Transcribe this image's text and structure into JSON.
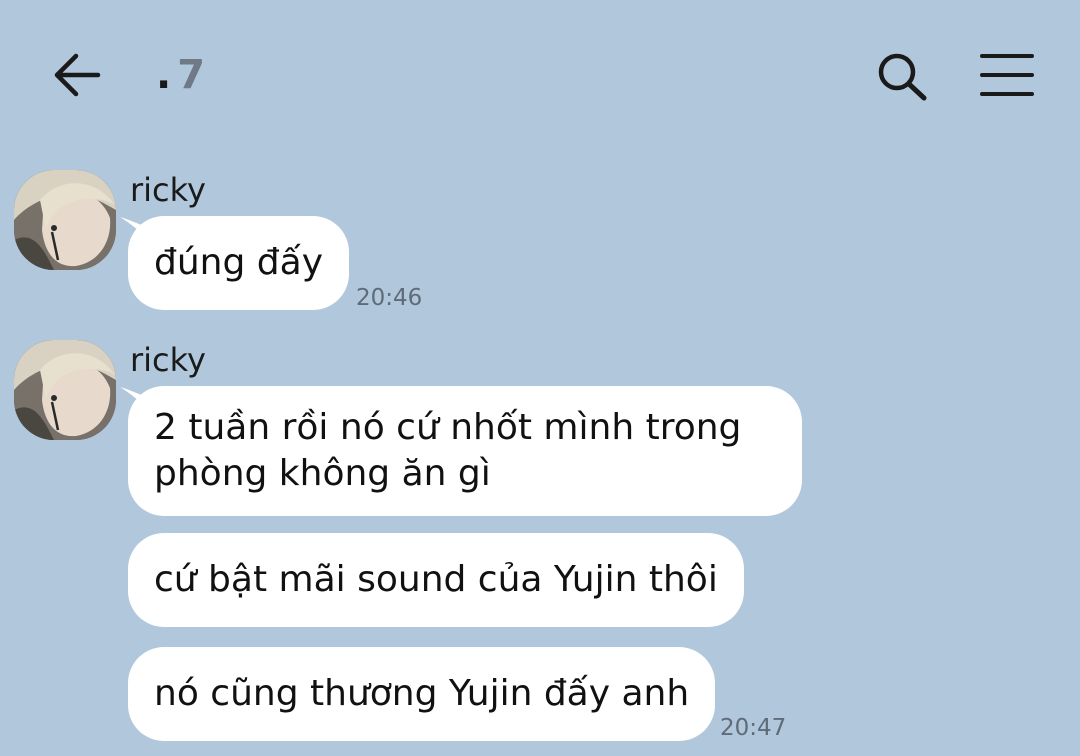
{
  "header": {
    "title_prefix": ".",
    "title": "7",
    "back_icon": "arrow-left-icon",
    "search_icon": "search-icon",
    "menu_icon": "hamburger-menu-icon"
  },
  "messages": [
    {
      "sender": "ricky",
      "bubbles": [
        {
          "text": "đúng đấy",
          "time": "20:46"
        }
      ]
    },
    {
      "sender": "ricky",
      "bubbles": [
        {
          "text_lines": [
            "2 tuần rồi nó cứ nhốt mình trong",
            "phòng không ăn gì"
          ]
        },
        {
          "text": "cứ bật mãi sound của Yujin thôi"
        },
        {
          "text": "nó cũng thương Yujin đấy anh",
          "time": "20:47"
        }
      ]
    }
  ],
  "colors": {
    "background": "#b1c7dc",
    "bubble": "#ffffff",
    "title": "#707a86",
    "time": "#5f6b78"
  }
}
